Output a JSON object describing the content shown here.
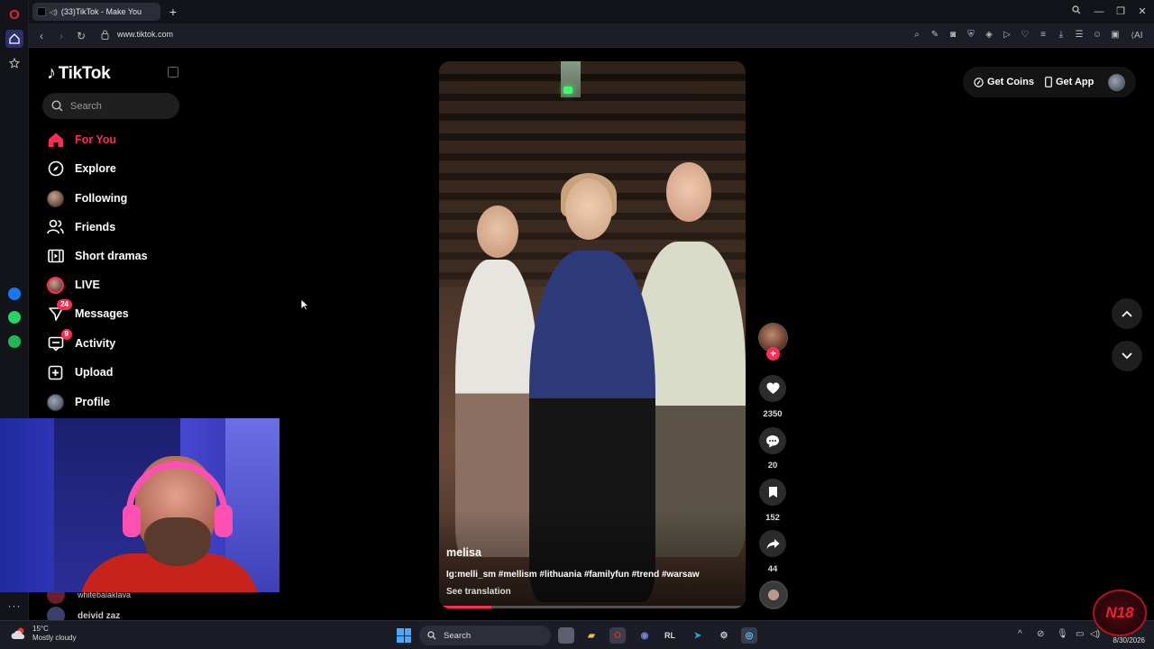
{
  "browser": {
    "tab_title": "(33)TikTok - Make You",
    "url": "www.tiktok.com",
    "ai_label": "AI"
  },
  "tiktok": {
    "logo": "TikTok",
    "search_placeholder": "Search",
    "nav": [
      {
        "label": "For You",
        "icon": "home-icon",
        "active": true
      },
      {
        "label": "Explore",
        "icon": "compass-icon"
      },
      {
        "label": "Following",
        "icon": "following-avatar-icon"
      },
      {
        "label": "Friends",
        "icon": "friends-icon"
      },
      {
        "label": "Short dramas",
        "icon": "film-icon"
      },
      {
        "label": "LIVE",
        "icon": "live-avatar-icon"
      },
      {
        "label": "Messages",
        "icon": "messages-icon",
        "badge": "24"
      },
      {
        "label": "Activity",
        "icon": "activity-icon",
        "badge": "9"
      },
      {
        "label": "Upload",
        "icon": "upload-icon"
      },
      {
        "label": "Profile",
        "icon": "profile-avatar-icon"
      }
    ],
    "following_accounts": [
      {
        "name": "whitebalaklava"
      },
      {
        "name": "deivid zaz"
      }
    ],
    "video": {
      "username": "melisa",
      "caption": "Ig:melli_sm #mellism #lithuania #familyfun #trend #warsaw",
      "see_translation": "See translation",
      "progress": 0.17
    },
    "actions": {
      "likes": "2350",
      "comments": "20",
      "saves": "152",
      "shares": "44"
    },
    "top_right": {
      "get_coins": "Get Coins",
      "get_app": "Get App"
    }
  },
  "taskbar": {
    "temperature": "15°C",
    "weather": "Mostly cloudy",
    "search": "Search",
    "date": "8/30/2026"
  },
  "colors": {
    "accent": "#fe2c55",
    "background": "#000000"
  }
}
